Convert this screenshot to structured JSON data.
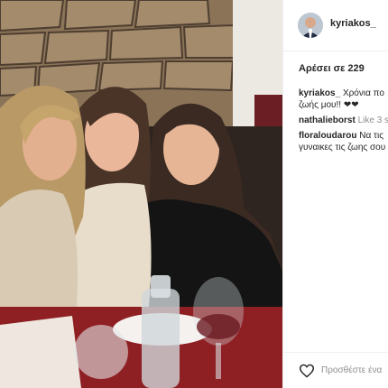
{
  "post": {
    "username": "kyriakos_",
    "likes_text": "Αρέσει σε 229",
    "comments": [
      {
        "author": "kyriakos_",
        "text_line1": "Χρόνια πο",
        "text_line2": "ζωής μου!! ❤❤"
      },
      {
        "author": "nathalieborst",
        "text_line1": "Like 3 s",
        "text_line2": ""
      },
      {
        "author": "floraloudarou",
        "text_line1": "Να τις",
        "text_line2": "γυναικες τις ζωης σου"
      }
    ],
    "add_comment_placeholder": "Προσθέστε ένα"
  },
  "icons": {
    "like": "heart-icon",
    "avatar": "user-avatar"
  }
}
